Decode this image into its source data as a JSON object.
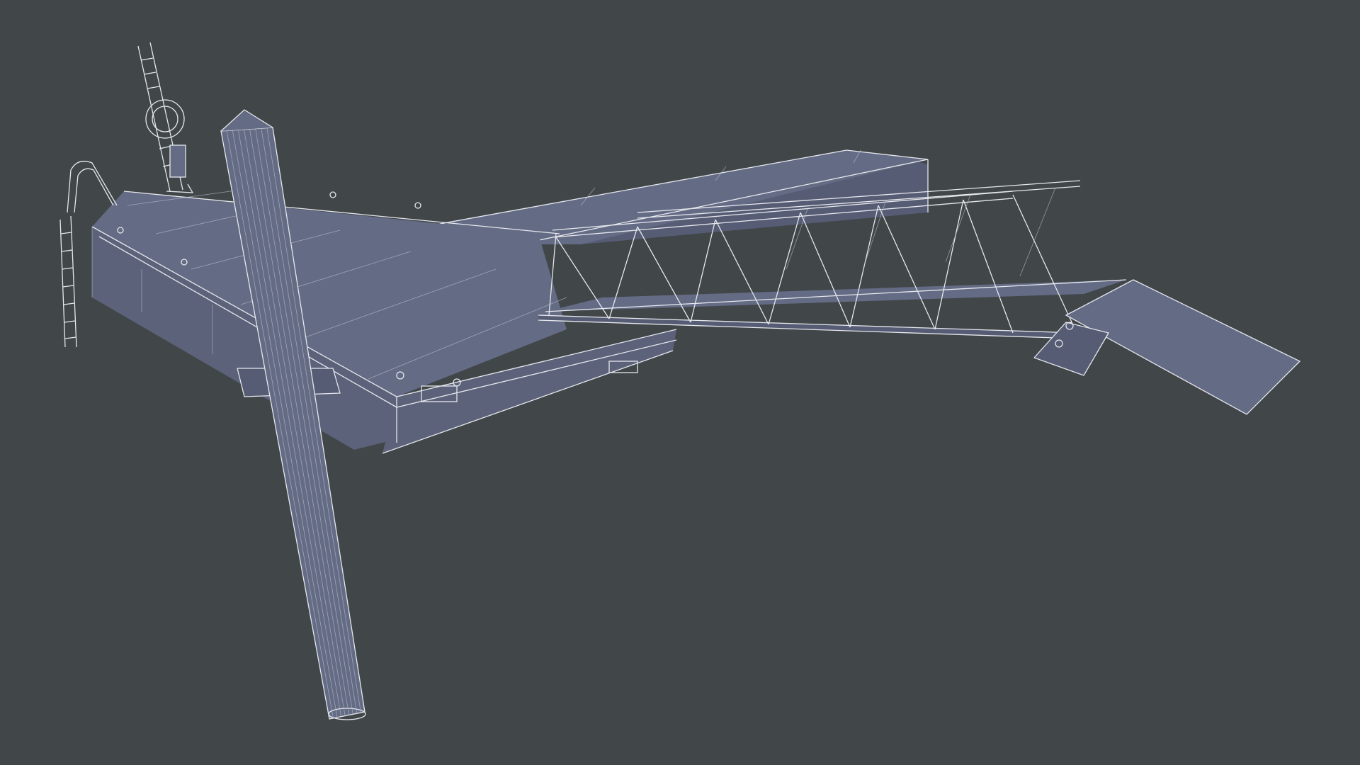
{
  "colors": {
    "background": "#414649",
    "surface": "#646b84",
    "surface_dark": "#565c73",
    "surface_side": "#5c6279",
    "wire": "#e6e8ee",
    "wire_faint": "#b9bdc9"
  }
}
